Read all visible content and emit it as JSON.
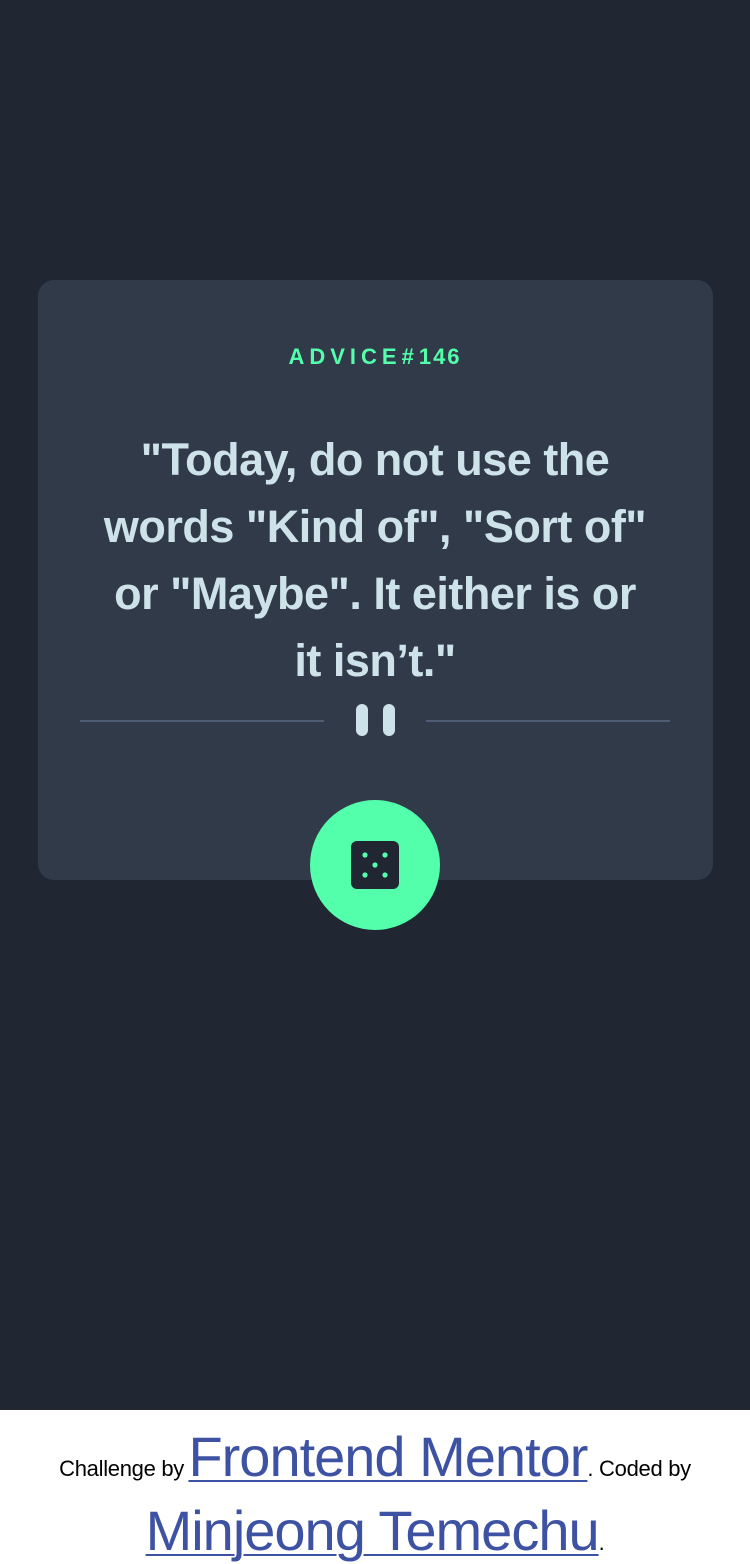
{
  "advice": {
    "label": "ADVICE",
    "hash": "#",
    "number": "146",
    "quote": "\"Today, do not use the words \"Kind of\", \"Sort of\" or \"Maybe\". It either is or it isn’t.\""
  },
  "divider": {
    "icon": "pause-icon"
  },
  "button": {
    "icon": "dice-icon"
  },
  "footer": {
    "challenge_text": "Challenge by",
    "frontend_link": "Frontend Mentor",
    "coded_text": ". Coded by",
    "author_link": "Minjeong Temechu",
    "end": "."
  },
  "colors": {
    "background": "#202733",
    "card": "#313a49",
    "accent": "#53ffaa",
    "text": "#cee3e9",
    "divider": "#4f5d74",
    "link": "#3e52a3"
  }
}
